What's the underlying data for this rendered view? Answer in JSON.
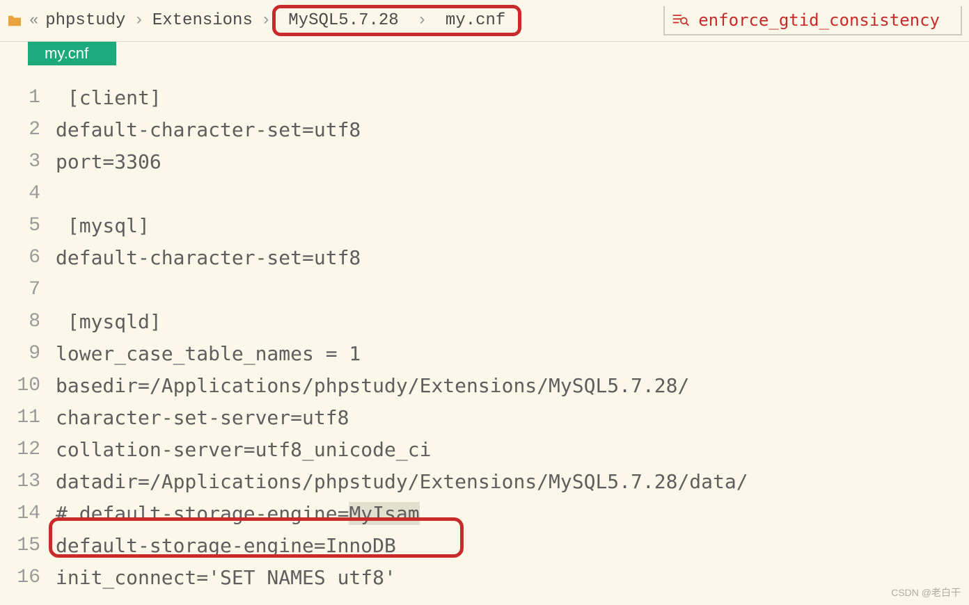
{
  "breadcrumb": {
    "items": [
      "phpstudy",
      "Extensions",
      "MySQL5.7.28",
      "my.cnf"
    ],
    "highlighted_start": 2,
    "highlighted_end": 3
  },
  "search": {
    "text": "enforce_gtid_consistency"
  },
  "tab": {
    "label": "my.cnf"
  },
  "code": {
    "lines": [
      {
        "n": 1,
        "text": " [client]"
      },
      {
        "n": 2,
        "text": "default-character-set=utf8"
      },
      {
        "n": 3,
        "text": "port=3306"
      },
      {
        "n": 4,
        "text": ""
      },
      {
        "n": 5,
        "text": " [mysql]"
      },
      {
        "n": 6,
        "text": "default-character-set=utf8"
      },
      {
        "n": 7,
        "text": ""
      },
      {
        "n": 8,
        "text": " [mysqld]"
      },
      {
        "n": 9,
        "text": "lower_case_table_names = 1"
      },
      {
        "n": 10,
        "text": "basedir=/Applications/phpstudy/Extensions/MySQL5.7.28/"
      },
      {
        "n": 11,
        "text": "character-set-server=utf8"
      },
      {
        "n": 12,
        "text": "collation-server=utf8_unicode_ci"
      },
      {
        "n": 13,
        "text": "datadir=/Applications/phpstudy/Extensions/MySQL5.7.28/data/"
      },
      {
        "n": 14,
        "text": "# default-storage-engine=",
        "hl": "MyIsam"
      },
      {
        "n": 15,
        "text": "default-storage-engine=InnoDB",
        "boxed": true
      },
      {
        "n": 16,
        "text": "init_connect='SET NAMES utf8'"
      }
    ]
  },
  "watermark": "CSDN @老白干"
}
